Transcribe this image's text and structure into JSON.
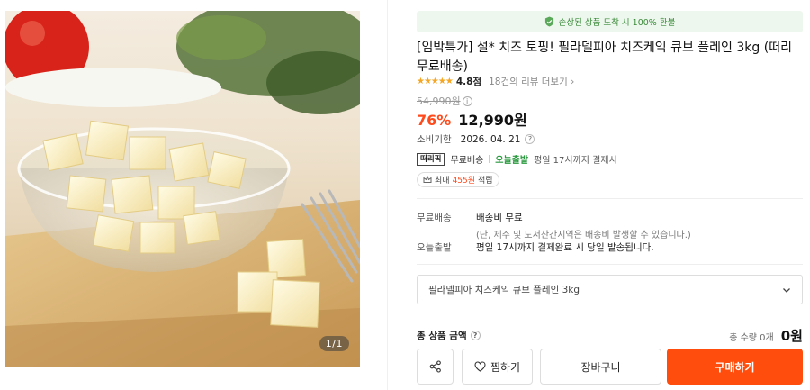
{
  "gallery": {
    "counter": "1/1",
    "image_icon": "cheese-cubes-photo"
  },
  "notice": {
    "text": "손상된 상품 도착 시 100% 환불",
    "icon": "shield-check-icon",
    "color": "#3a8a3a"
  },
  "product": {
    "title": "[임박특가] 설* 치즈 토핑! 필라델피아 치즈케익 큐브 플레인 3kg (떠리무료배송)",
    "stars": "★★★★★",
    "rating": "4.8점",
    "review_link": "18건의 리뷰 더보기 ›",
    "original_price": "54,990원",
    "discount": "76%",
    "sale_price": "12,990원",
    "expiry_label": "소비기한",
    "expiry_value": "2026. 04. 21",
    "badge": "떠리픽",
    "free_shipping": "무료배송",
    "today_ship": "오늘출발",
    "today_ship_note": "평일 17시까지 결제시",
    "points_prefix": "최대",
    "points_amount": "455원",
    "points_suffix": "적립"
  },
  "shipping": {
    "fee_label": "무료배송",
    "fee_value": "배송비 무료",
    "fee_sub": "(단, 제주 및 도서산간지역은 배송비 발생할 수 있습니다.)",
    "today_label": "오늘출발",
    "today_value": "평일 17시까지 결제완료 시 당일 발송됩니다."
  },
  "option": {
    "selected": "필라델피아 치즈케익 큐브 플레인 3kg"
  },
  "total": {
    "label": "총 상품 금액",
    "qty": "총 수량 0개",
    "price": "0원"
  },
  "buttons": {
    "wish": "찜하기",
    "cart": "장바구니",
    "buy": "구매하기"
  },
  "colors": {
    "accent": "#ff4d0d",
    "discount": "#ff4a1c",
    "today_ship": "#2a9a3f",
    "star": "#f5a623"
  }
}
